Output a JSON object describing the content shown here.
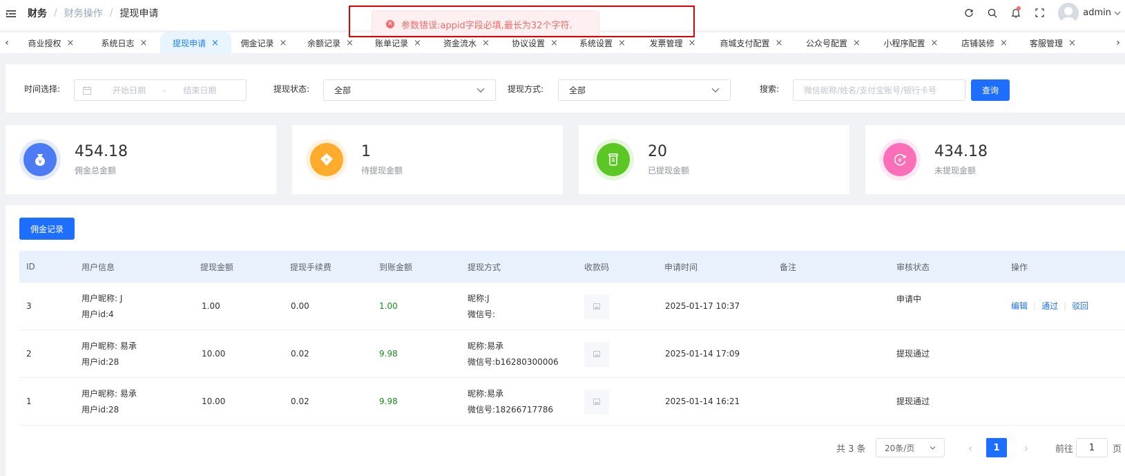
{
  "header": {
    "breadcrumb": [
      "财务",
      "财务操作",
      "提现申请"
    ],
    "separator": "/",
    "username": "admin"
  },
  "toast": {
    "message": "参数错误:appid字段必填,最长为32个字符."
  },
  "tabs": [
    {
      "label": "商业授权"
    },
    {
      "label": "系统日志"
    },
    {
      "label": "提现申请",
      "active": true
    },
    {
      "label": "佣金记录"
    },
    {
      "label": "余额记录"
    },
    {
      "label": "账单记录"
    },
    {
      "label": "资金流水"
    },
    {
      "label": "协议设置"
    },
    {
      "label": "系统设置"
    },
    {
      "label": "发票管理"
    },
    {
      "label": "商城支付配置"
    },
    {
      "label": "公众号配置"
    },
    {
      "label": "小程序配置"
    },
    {
      "label": "店铺装修"
    },
    {
      "label": "客服管理"
    }
  ],
  "filters": {
    "time_label": "时间选择:",
    "start_placeholder": "开始日期",
    "range_sep": "-",
    "end_placeholder": "结束日期",
    "status_label": "提现状态:",
    "status_value": "全部",
    "method_label": "提现方式:",
    "method_value": "全部",
    "search_label": "搜索:",
    "search_placeholder": "微信昵称/姓名/支付宝账号/银行卡号",
    "query_button": "查询"
  },
  "stats": [
    {
      "value": "454.18",
      "label": "佣金总金额",
      "color": "#4c7bf3",
      "ring": "#e3ebfd",
      "icon": "money-bag-icon"
    },
    {
      "value": "1",
      "label": "待提现金额",
      "color": "#ffab2b",
      "ring": "#fff3e0",
      "icon": "diamond-icon"
    },
    {
      "value": "20",
      "label": "已提现金额",
      "color": "#5ac725",
      "ring": "#e6f7dc",
      "icon": "cup-icon"
    },
    {
      "value": "434.18",
      "label": "未提现金额",
      "color": "#fa6fb7",
      "ring": "#fee8f3",
      "icon": "yen-refresh-icon"
    }
  ],
  "panel": {
    "commission_button": "佣金记录"
  },
  "table": {
    "columns": [
      "ID",
      "用户信息",
      "提现金额",
      "提现手续费",
      "到账金额",
      "提现方式",
      "收款码",
      "申请时间",
      "备注",
      "审核状态",
      "操作"
    ],
    "rows": [
      {
        "id": "3",
        "nickname": "用户昵称: J",
        "uid": "用户id:4",
        "amount": "1.00",
        "fee": "0.00",
        "received": "1.00",
        "method_nick": "昵称:J",
        "method_wx": "微信号:",
        "time": "2025-01-17 10:37",
        "remark": "",
        "status": "申请中",
        "ops": [
          "编辑",
          "通过",
          "驳回"
        ]
      },
      {
        "id": "2",
        "nickname": "用户昵称: 易承",
        "uid": "用户id:28",
        "amount": "10.00",
        "fee": "0.02",
        "received": "9.98",
        "method_nick": "昵称:易承",
        "method_wx": "微信号:b16280300006",
        "time": "2025-01-14 17:09",
        "remark": "",
        "status": "提现通过",
        "ops": []
      },
      {
        "id": "1",
        "nickname": "用户昵称: 易承",
        "uid": "用户id:28",
        "amount": "10.00",
        "fee": "0.02",
        "received": "9.98",
        "method_nick": "昵称:易承",
        "method_wx": "微信号:18266717786",
        "time": "2025-01-14 16:21",
        "remark": "",
        "status": "提现通过",
        "ops": []
      }
    ]
  },
  "pagination": {
    "total": "共 3 条",
    "page_size": "20条/页",
    "current_page": "1",
    "goto_label": "前往",
    "goto_value": "1",
    "page_unit": "页"
  }
}
